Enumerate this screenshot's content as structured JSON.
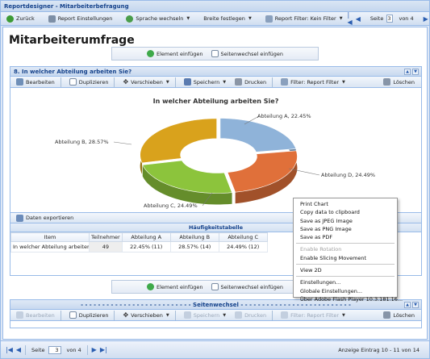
{
  "window": {
    "title": "Reportdesigner - Mitarbeiterbefragung"
  },
  "top_toolbar": {
    "back_label": "Zurück",
    "report_settings_label": "Report Einstellungen",
    "language_label": "Sprache wechseln",
    "width_label": "Breite festlegen",
    "filter_label": "Report Filter: Kein Filter",
    "page_label": "Seite",
    "page_value": "3",
    "of_label": "von 4"
  },
  "page": {
    "title": "Mitarbeiterumfrage"
  },
  "insert_bar": {
    "element_label": "Element einfügen",
    "pagebreak_label": "Seitenwechsel einfügen"
  },
  "section": {
    "title": "8.  In welcher Abteilung arbeiten Sie?",
    "toolbar": {
      "edit": "Bearbeiten",
      "duplicate": "Duplizieren",
      "move": "Verschieben",
      "save": "Speichern",
      "print": "Drucken",
      "filter": "Filter: Report Filter",
      "delete": "Löschen"
    }
  },
  "chart_data": {
    "type": "pie",
    "title": "In welcher Abteilung arbeiten Sie?",
    "categories": [
      "Abteilung A",
      "Abteilung B",
      "Abteilung C",
      "Abteilung D"
    ],
    "values": [
      22.45,
      28.57,
      24.49,
      24.49
    ],
    "labels": [
      "Abteilung A, 22.45%",
      "Abteilung B, 28.57%",
      "Abteilung C, 24.49%",
      "Abteilung D, 24.49%"
    ],
    "colors": [
      "#8fb3d9",
      "#d9a21c",
      "#8cc43c",
      "#e0703a"
    ],
    "style": "3d-donut"
  },
  "table_panel": {
    "export_label": "Daten exportieren",
    "caption": "Häufigkeitstabelle",
    "headers": [
      "Item",
      "Teilnehmer",
      "Abteilung A",
      "Abteilung B",
      "Abteilung C"
    ],
    "rows": [
      [
        "In welcher Abteilung arbeiten Si...",
        "49",
        "22.45% (11)",
        "28.57% (14)",
        "24.49% (12)"
      ]
    ]
  },
  "context_menu": {
    "items": [
      {
        "label": "Print Chart",
        "enabled": true
      },
      {
        "label": "Copy data to clipboard",
        "enabled": true
      },
      {
        "label": "Save as JPEG Image",
        "enabled": true
      },
      {
        "label": "Save as PNG Image",
        "enabled": true
      },
      {
        "label": "Save as PDF",
        "enabled": true
      },
      {
        "label": "Enable Rotation",
        "enabled": false
      },
      {
        "label": "Enable Slicing Movement",
        "enabled": true
      },
      {
        "label": "View 2D",
        "enabled": true
      },
      {
        "label": "Einstellungen...",
        "enabled": true
      },
      {
        "label": "Globale Einstellungen...",
        "enabled": true
      },
      {
        "label": "Über Adobe Flash Player 10.3.181.16...",
        "enabled": true
      }
    ]
  },
  "pagebreak_section": {
    "title": "- - - - - - - - - - - - - - - - - - - - - - - - - -  Seitenwechsel  - - - - - - - - - - - - - - - - - - - - - - - - - -",
    "toolbar": {
      "edit": "Bearbeiten",
      "duplicate": "Duplizieren",
      "move": "Verschieben",
      "save": "Speichern",
      "print": "Drucken",
      "filter": "Filter: Report Filter",
      "delete": "Löschen"
    }
  },
  "status_bar": {
    "page_label": "Seite",
    "page_value": "3",
    "of_label": "von 4",
    "entries": "Anzeige Eintrag 10 - 11 von 14"
  },
  "colors": {
    "accent": "#15428b",
    "border": "#99bbe8",
    "panel": "#dfe8f6"
  }
}
